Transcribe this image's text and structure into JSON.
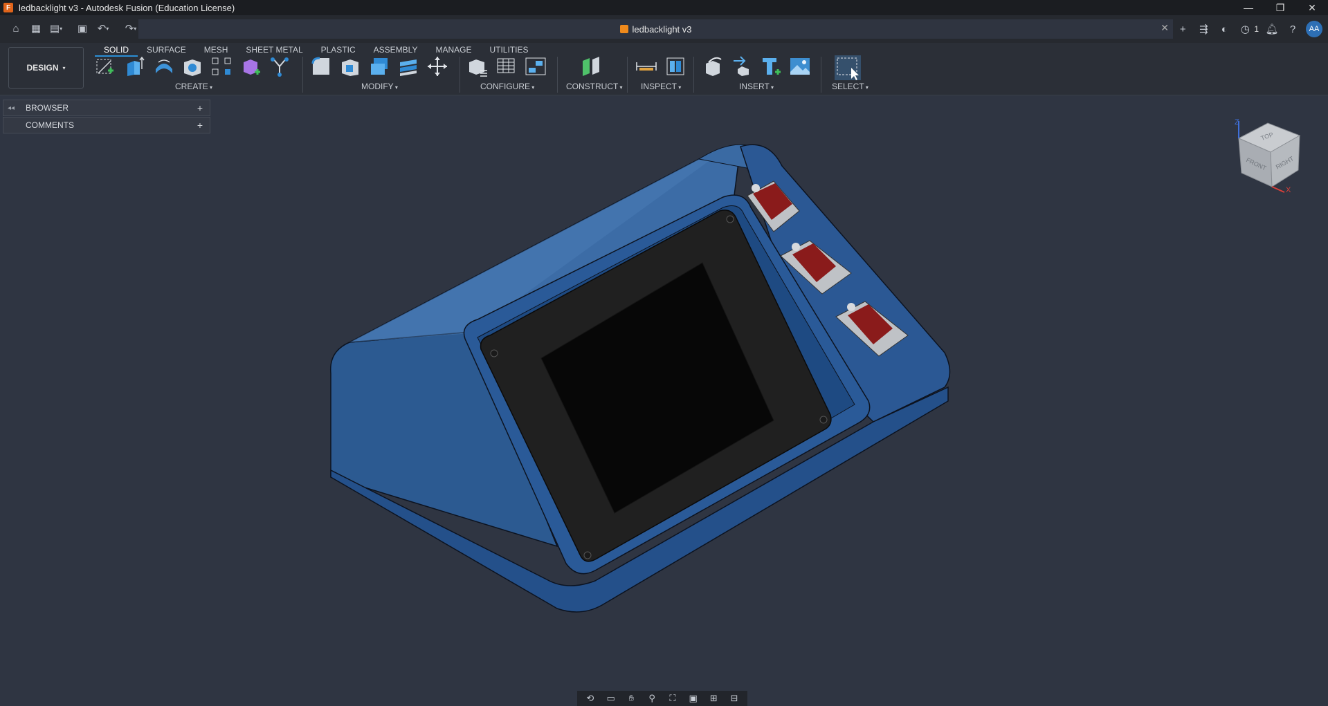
{
  "window": {
    "title": "ledbacklight v3 - Autodesk Fusion (Education License)",
    "logo_letter": "F",
    "controls": [
      "minimize-icon",
      "restore-icon",
      "close-icon"
    ]
  },
  "quick_access": {
    "icons": [
      "home-icon",
      "grid-icon",
      "file-icon",
      "save-icon",
      "undo-icon",
      "redo-icon"
    ],
    "document_tab": "ledbacklight v3",
    "right_icons": [
      "add-icon",
      "extensions-icon",
      "online-icon",
      "jobs-icon",
      "notifications-icon",
      "help-icon"
    ],
    "job_count": "1",
    "avatar_initials": "AA"
  },
  "toolbar": {
    "workspace": "DESIGN",
    "tabs": [
      "SOLID",
      "SURFACE",
      "MESH",
      "SHEET METAL",
      "PLASTIC",
      "ASSEMBLY",
      "MANAGE",
      "UTILITIES"
    ],
    "active_tab": "SOLID",
    "groups": {
      "create": "CREATE",
      "modify": "MODIFY",
      "configure": "CONFIGURE",
      "construct": "CONSTRUCT",
      "inspect": "INSPECT",
      "insert": "INSERT",
      "select": "SELECT"
    }
  },
  "browser": {
    "browser_label": "BROWSER",
    "comments_label": "COMMENTS"
  },
  "viewcube": {
    "top": "TOP",
    "front": "FRONT",
    "right": "RIGHT",
    "axis_z": "Z",
    "axis_x": "X"
  },
  "colors": {
    "accent": "#2b8fd6",
    "model_body": "#2d5a92",
    "viewport_bg": "#2f3542",
    "screen": "#0b0b0b",
    "switch_stem": "#8b1e1e"
  }
}
